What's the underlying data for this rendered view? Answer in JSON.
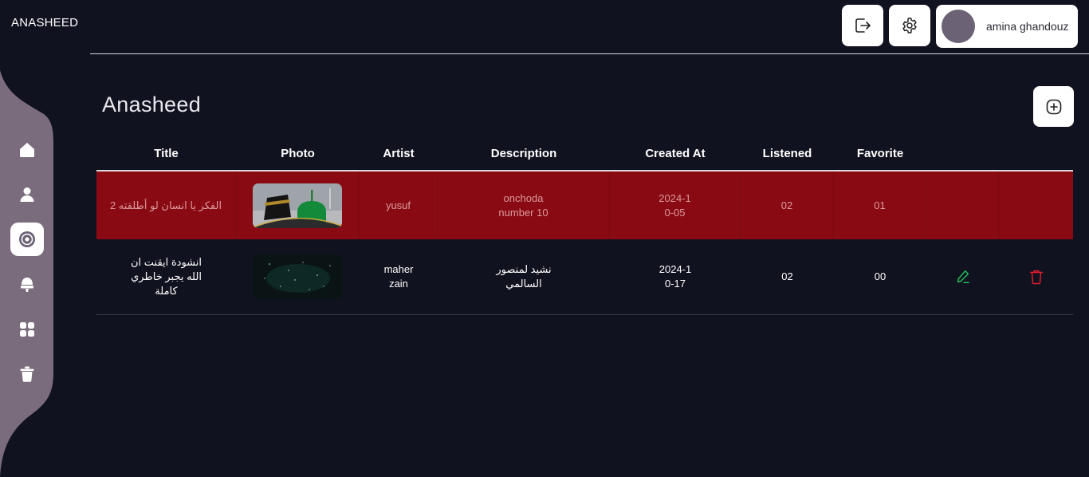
{
  "app": {
    "brand": "ANASHEED"
  },
  "header": {
    "user_name": "amina ghandouz",
    "logout_icon": "logout-icon",
    "settings_icon": "gear-icon"
  },
  "sidebar": {
    "items": [
      {
        "icon": "home-icon"
      },
      {
        "icon": "user-icon"
      },
      {
        "icon": "disc-icon",
        "active": true
      },
      {
        "icon": "microphone-icon"
      },
      {
        "icon": "grid-icon"
      },
      {
        "icon": "trash-icon"
      }
    ]
  },
  "main": {
    "title": "Anasheed",
    "add_icon": "plus-square-icon",
    "table": {
      "columns": [
        "Title",
        "Photo",
        "Artist",
        "Description",
        "Created At",
        "Listened",
        "Favorite"
      ],
      "rows": [
        {
          "title": "الفكر يا انسان لو أطلقته 2",
          "artist": "yusuf",
          "description": "onchoda number 10",
          "created_at": "2024-10-05",
          "listened": "02",
          "favorite": "01"
        },
        {
          "title": "انشودة ايقنت ان الله يجبر خاطري كاملة",
          "artist": "maher zain",
          "description": "نشيد لمنصور السالمي",
          "created_at": "2024-10-17",
          "listened": "02",
          "favorite": "00"
        }
      ]
    }
  },
  "colors": {
    "background": "#11121f",
    "sidebar": "#7a6c7c",
    "highlight_row": "#8a0a13",
    "edit": "#22c55e",
    "delete": "#e11d2a"
  }
}
